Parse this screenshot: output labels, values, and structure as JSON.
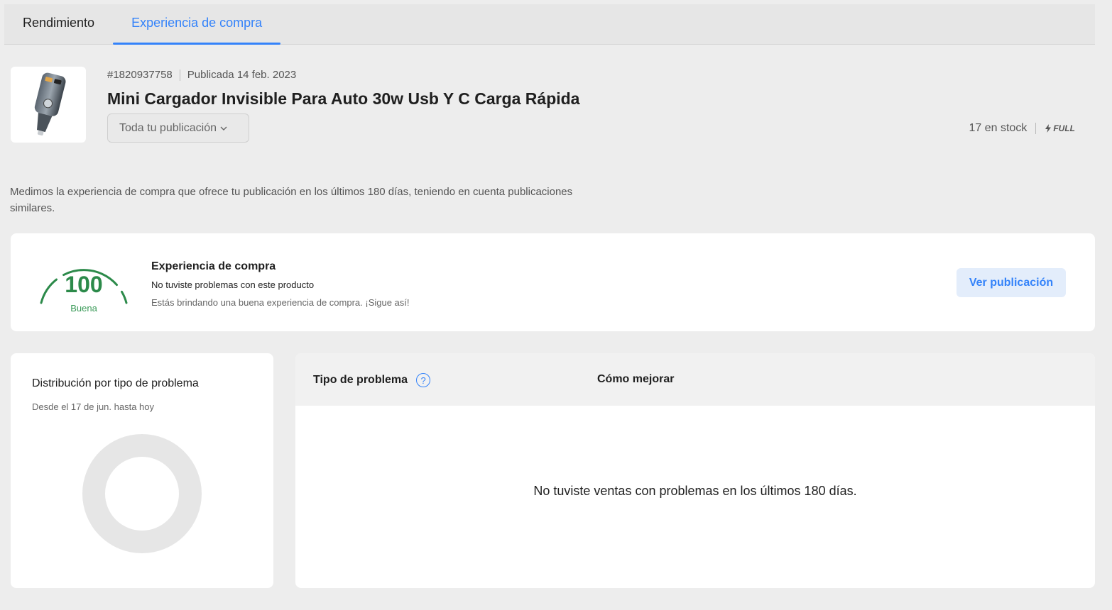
{
  "tabs": [
    {
      "label": "Rendimiento",
      "active": false
    },
    {
      "label": "Experiencia de compra",
      "active": true
    }
  ],
  "product": {
    "id": "#1820937758",
    "published": "Publicada 14 feb. 2023",
    "title": "Mini Cargador Invisible Para Auto 30w Usb Y C Carga Rápida",
    "filter_label": "Toda tu publicación",
    "stock": "17 en stock",
    "fulfillment": "FULL",
    "image_icon": "car-charger-image"
  },
  "description": "Medimos la experiencia de compra que ofrece tu publicación en los últimos 180 días, teniendo en cuenta publicaciones similares.",
  "experience": {
    "score": "100",
    "rating": "Buena",
    "title": "Experiencia de compra",
    "subtitle": "No tuviste problemas con este producto",
    "note": "Estás brindando una buena experiencia de compra. ¡Sigue así!",
    "button_label": "Ver publicación"
  },
  "distribution": {
    "title": "Distribución por tipo de problema",
    "subtitle": "Desde el 17 de jun. hasta hoy"
  },
  "problems_table": {
    "col_type": "Tipo de problema",
    "col_improve": "Cómo mejorar",
    "empty_message": "No tuviste ventas con problemas en los últimos 180 días."
  },
  "colors": {
    "accent": "#3483fa",
    "good": "#2c8a4a",
    "donut_empty": "#e6e6e6"
  }
}
